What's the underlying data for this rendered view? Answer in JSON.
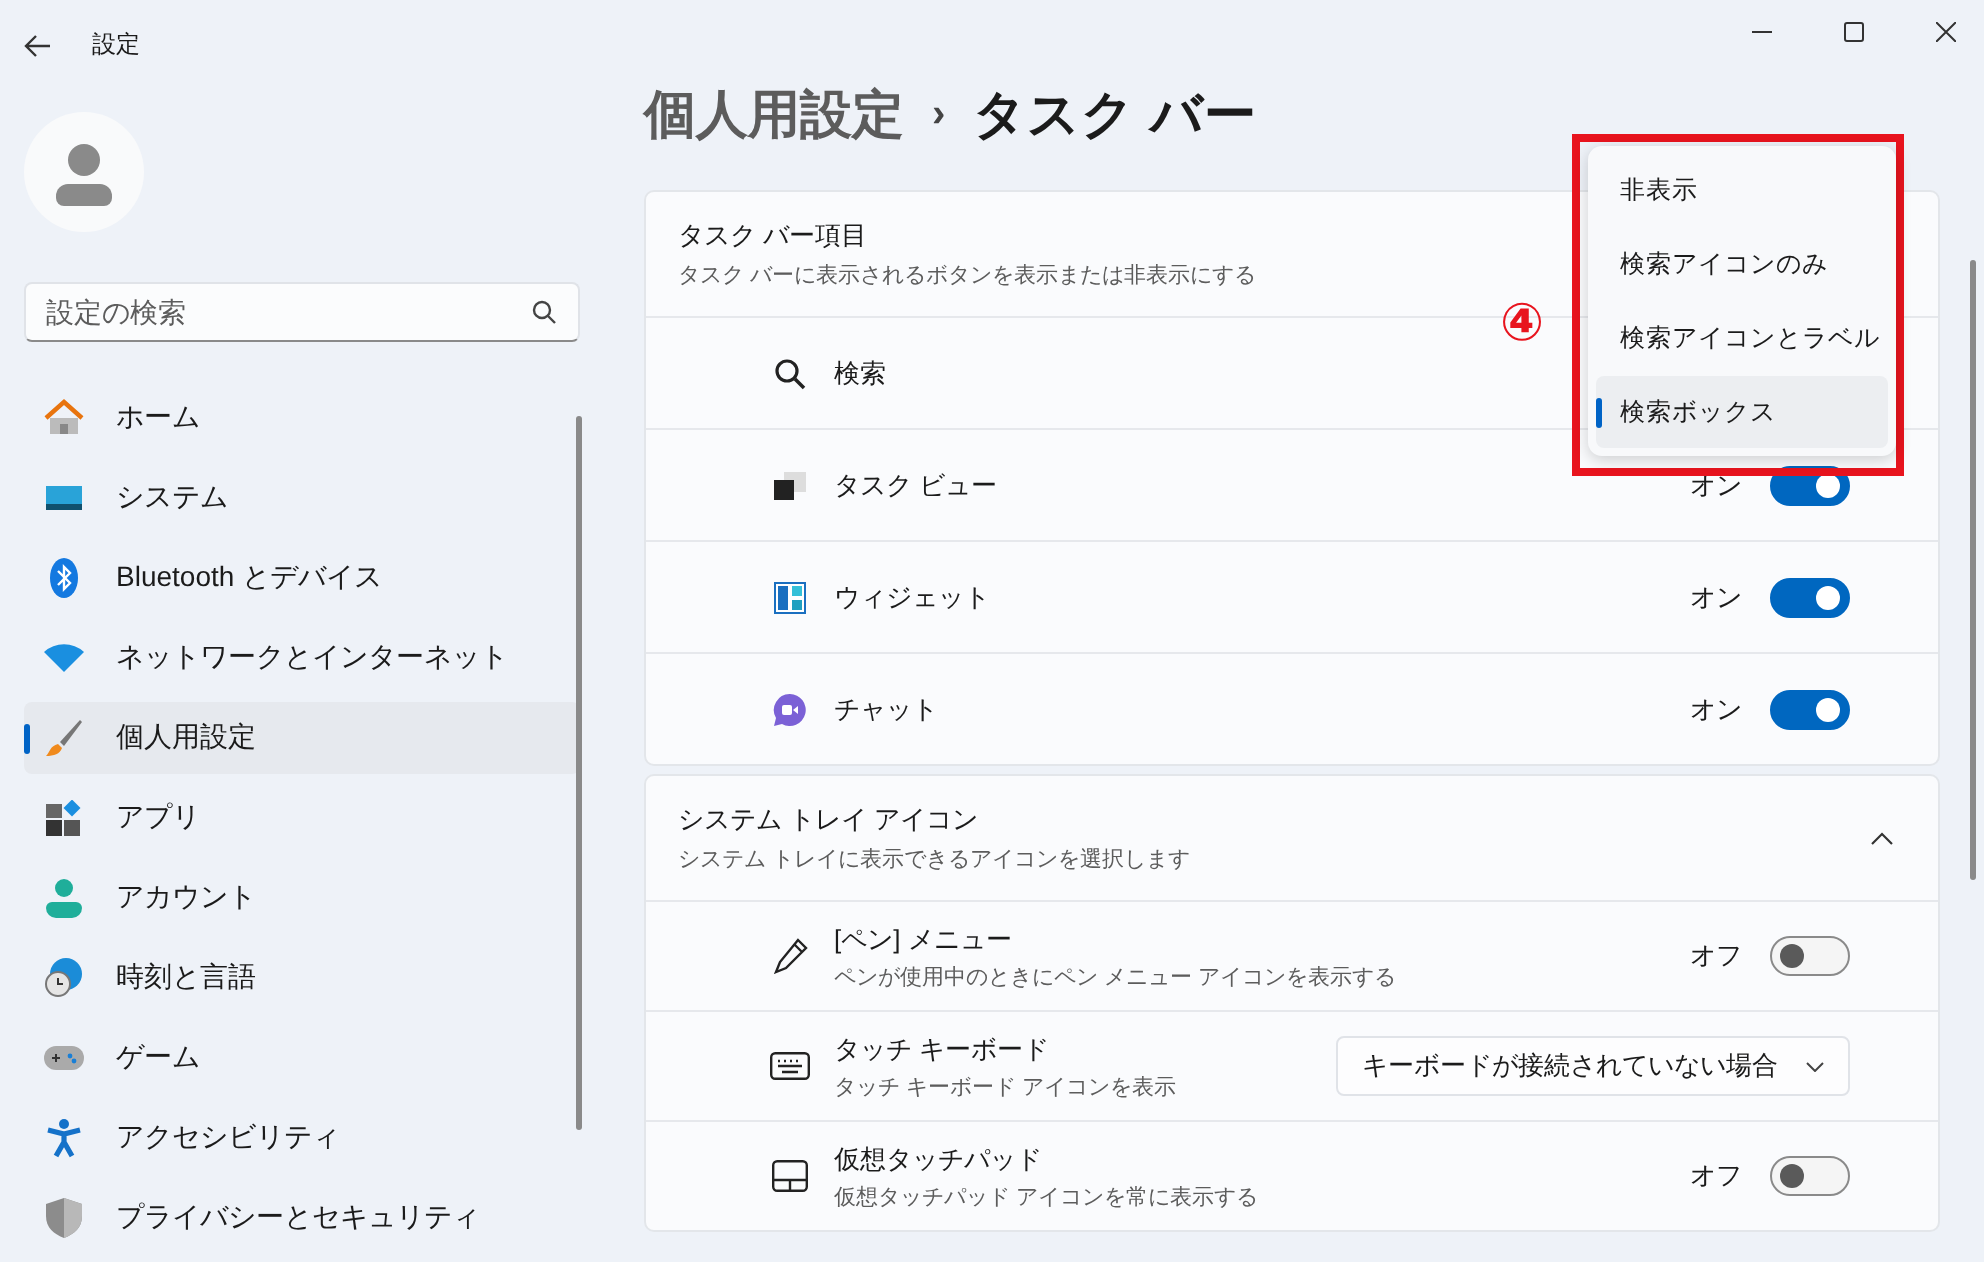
{
  "window": {
    "title": "設定"
  },
  "search": {
    "placeholder": "設定の検索"
  },
  "nav": [
    {
      "label": "ホーム",
      "selected": false
    },
    {
      "label": "システム",
      "selected": false
    },
    {
      "label": "Bluetooth とデバイス",
      "selected": false
    },
    {
      "label": "ネットワークとインターネット",
      "selected": false
    },
    {
      "label": "個人用設定",
      "selected": true
    },
    {
      "label": "アプリ",
      "selected": false
    },
    {
      "label": "アカウント",
      "selected": false
    },
    {
      "label": "時刻と言語",
      "selected": false
    },
    {
      "label": "ゲーム",
      "selected": false
    },
    {
      "label": "アクセシビリティ",
      "selected": false
    },
    {
      "label": "プライバシーとセキュリティ",
      "selected": false
    }
  ],
  "breadcrumb": {
    "parent": "個人用設定",
    "separator": "›",
    "current": "タスク バー"
  },
  "sections": [
    {
      "title": "タスク バー項目",
      "subtitle": "タスク バーに表示されるボタンを表示または非表示にする",
      "expanded": true,
      "rows": [
        {
          "kind": "plain",
          "label": "検索"
        },
        {
          "kind": "toggle",
          "label": "タスク ビュー",
          "state_text": "オン",
          "on": true
        },
        {
          "kind": "toggle",
          "label": "ウィジェット",
          "state_text": "オン",
          "on": true
        },
        {
          "kind": "toggle",
          "label": "チャット",
          "state_text": "オン",
          "on": true
        }
      ]
    },
    {
      "title": "システム トレイ アイコン",
      "subtitle": "システム トレイに表示できるアイコンを選択します",
      "expanded": true,
      "rows": [
        {
          "kind": "toggle",
          "label": "[ペン] メニュー",
          "subtitle": "ペンが使用中のときにペン メニュー アイコンを表示する",
          "state_text": "オフ",
          "on": false
        },
        {
          "kind": "dropdown",
          "label": "タッチ キーボード",
          "subtitle": "タッチ キーボード アイコンを表示",
          "value": "キーボードが接続されていない場合"
        },
        {
          "kind": "toggle",
          "label": "仮想タッチパッド",
          "subtitle": "仮想タッチパッド アイコンを常に表示する",
          "state_text": "オフ",
          "on": false
        }
      ]
    }
  ],
  "popup": {
    "options": [
      {
        "label": "非表示",
        "selected": false
      },
      {
        "label": "検索アイコンのみ",
        "selected": false
      },
      {
        "label": "検索アイコンとラベル",
        "selected": false
      },
      {
        "label": "検索ボックス",
        "selected": true
      }
    ]
  },
  "annotation": {
    "label": "④"
  }
}
